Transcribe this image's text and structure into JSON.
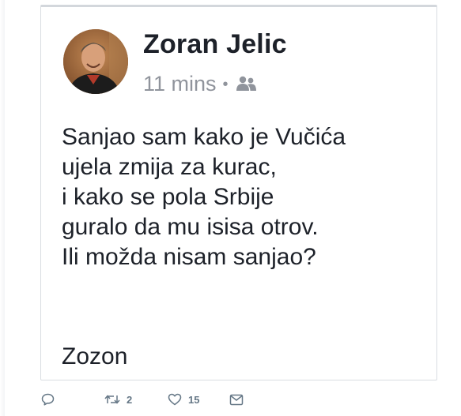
{
  "post": {
    "author": "Zoran Jelic",
    "time": "11 mins",
    "separator": "•",
    "audience_icon": "friends-icon",
    "text": "Sanjao sam kako je Vučića\nujela zmija za kurac,\ni kako se pola Srbije\nguralo da mu isisa otrov.\nIli možda nisam sanjao?",
    "signature": "Zozon"
  },
  "tweet_actions": {
    "reply_icon": "reply-icon",
    "retweet_icon": "retweet-icon",
    "retweet_count": "2",
    "like_icon": "heart-icon",
    "like_count": "15",
    "message_icon": "direct-message-icon"
  },
  "colors": {
    "text": "#1d2129",
    "meta": "#90949c",
    "action": "#657786",
    "card_border": "#d9dde2"
  }
}
